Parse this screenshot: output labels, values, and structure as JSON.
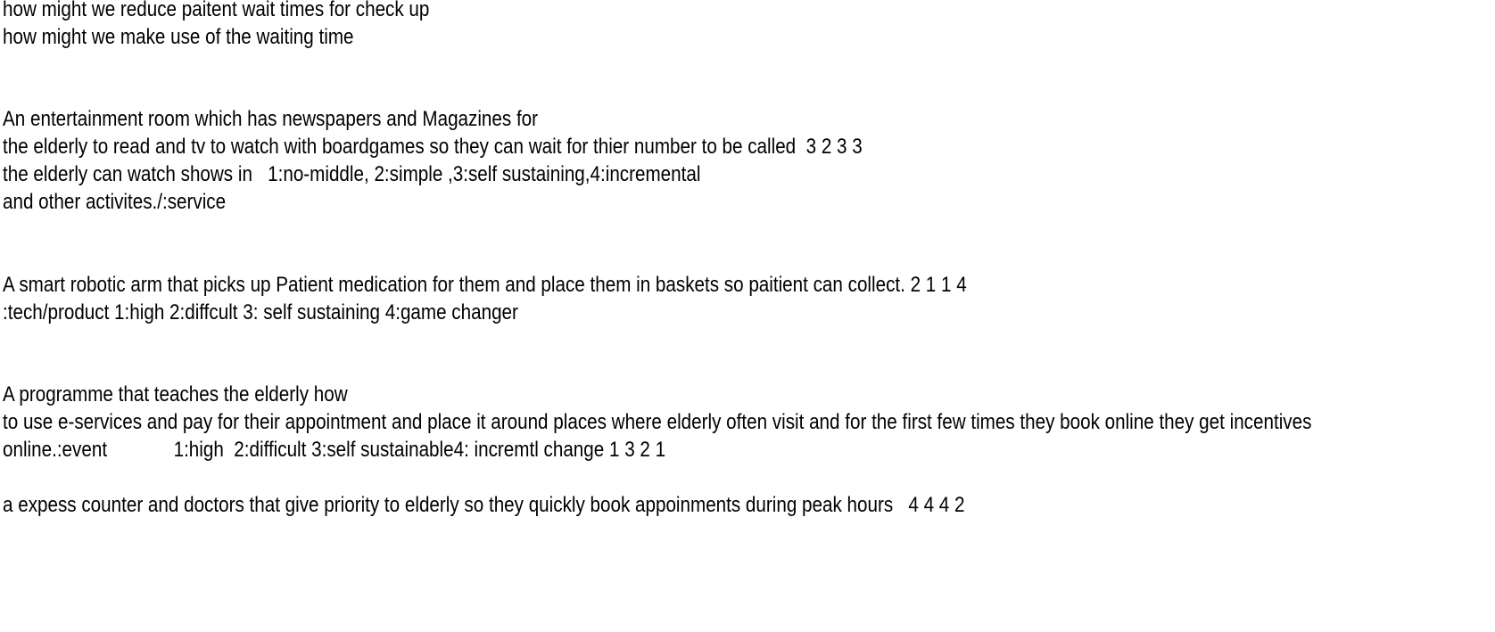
{
  "document": {
    "lines": [
      "how might we reduce paitent wait times for check up",
      "how might we make use of the waiting time",
      "An entertainment room which has newspapers and Magazines for",
      "the elderly to read and tv to watch with boardgames so they can wait for thier number to be called  3 2 3 3",
      "the elderly can watch shows in   1:no-middle, 2:simple ,3:self sustaining,4:incremental",
      "and other activites./:service",
      "A smart robotic arm that picks up Patient medication for them and place them in baskets so paitient can collect. 2 1 1 4",
      ":tech/product 1:high 2:diffcult 3: self sustaining 4:game changer",
      "A programme that teaches the elderly how",
      "to use e-services and pay for their appointment and place it around places where elderly often visit and for the first few times they book online they get incentives",
      "online.:event             1:high  2:difficult 3:self sustainable4: incremtl change 1 3 2 1",
      "a expess counter and doctors that give priority to elderly so they quickly book appoinments during peak hours   4 4 4 2"
    ]
  }
}
